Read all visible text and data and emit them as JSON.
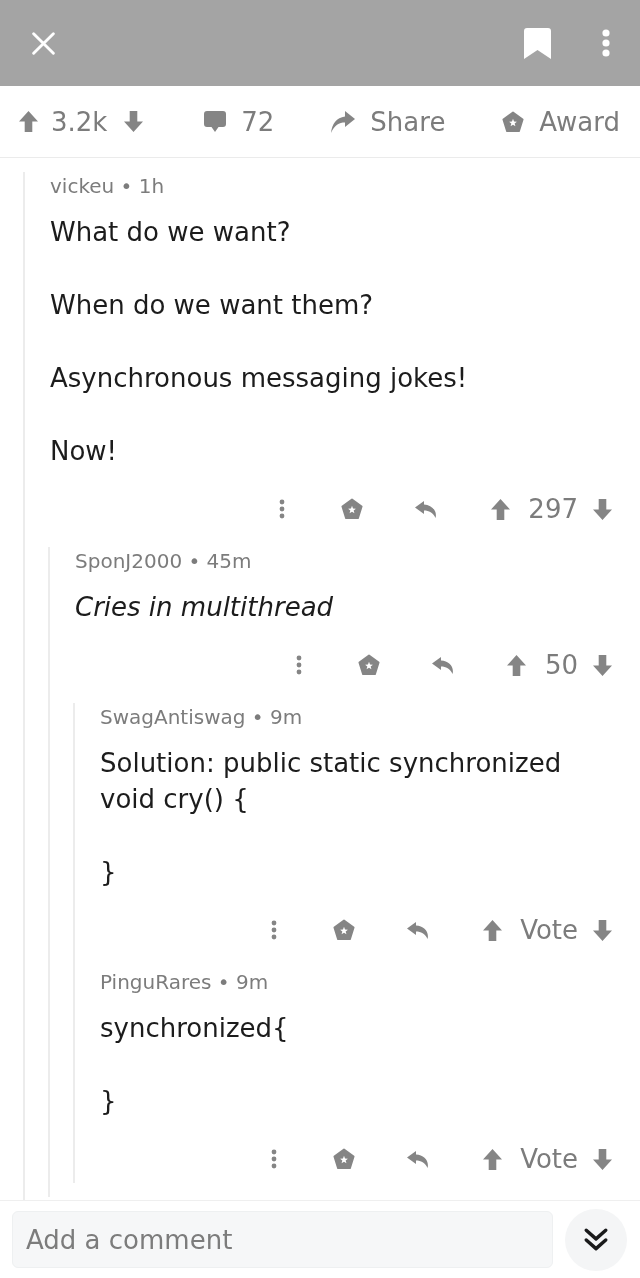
{
  "post_actions": {
    "score": "3.2k",
    "comments": "72",
    "share": "Share",
    "award": "Award"
  },
  "comments": [
    {
      "byline": "vickeu • 1h",
      "italic": false,
      "body": [
        "What do we want?",
        "When do we want them?",
        "Asynchronous messaging jokes!",
        "Now!"
      ],
      "score": "297",
      "children": [
        {
          "byline": "SponJ2000 • 45m",
          "italic": true,
          "body": [
            "Cries in multithread"
          ],
          "score": "50",
          "children": [
            {
              "byline": "SwagAntiswag • 9m",
              "italic": false,
              "body": [
                "Solution: public static synchronized void cry() {",
                "}"
              ],
              "score": "Vote"
            },
            {
              "byline": "PinguRares • 9m",
              "italic": false,
              "body": [
                "synchronized{",
                "}"
              ],
              "score": "Vote"
            }
          ]
        }
      ]
    }
  ],
  "comment_box": {
    "placeholder": "Add a comment"
  }
}
